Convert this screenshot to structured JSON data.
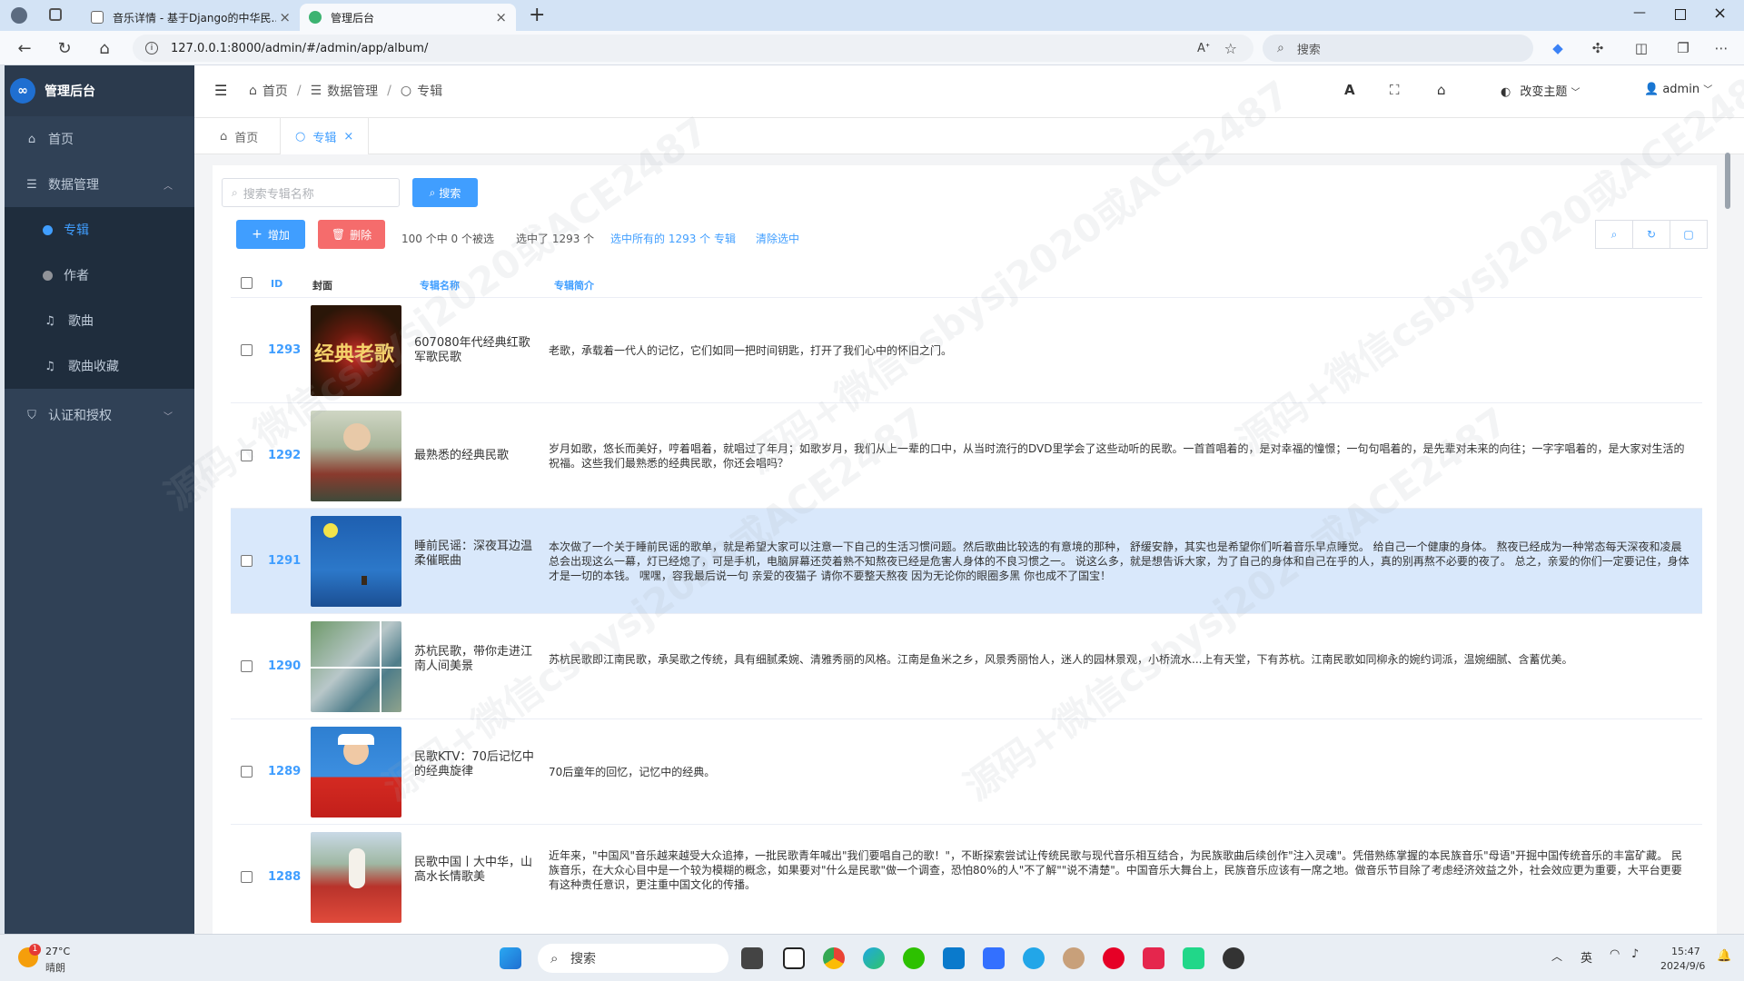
{
  "browser": {
    "tabs": [
      {
        "title": "音乐详情 - 基于Django的中华民..."
      },
      {
        "title": "管理后台"
      }
    ],
    "url": "127.0.0.1:8000/admin/#/admin/app/album/",
    "search_placeholder": "搜索"
  },
  "sidebar": {
    "brand": "管理后台",
    "home": "首页",
    "data_mgmt": "数据管理",
    "items": [
      {
        "label": "专辑"
      },
      {
        "label": "作者"
      },
      {
        "label": "歌曲"
      },
      {
        "label": "歌曲收藏"
      }
    ],
    "auth": "认证和授权"
  },
  "header": {
    "breadcrumb": [
      "首页",
      "数据管理",
      "专辑"
    ],
    "font_icon": "A",
    "theme": "改变主题",
    "user": "admin"
  },
  "page_tabs": [
    {
      "label": "首页"
    },
    {
      "label": "专辑"
    }
  ],
  "toolbar": {
    "search_placeholder": "搜索专辑名称",
    "search_btn": "搜索",
    "add_btn": "增加",
    "delete_btn": "删除",
    "selected_info": "100 个中 0 个被选",
    "selected_count": "选中了 1293 个",
    "select_all": "选中所有的 1293 个 专辑",
    "clear": "清除选中"
  },
  "table": {
    "columns": [
      "ID",
      "封面",
      "专辑名称",
      "专辑简介"
    ],
    "rows": [
      {
        "id": "1293",
        "name": "607080年代经典红歌军歌民歌",
        "desc": "老歌，承载着一代人的记忆，它们如同一把时间钥匙，打开了我们心中的怀旧之门。"
      },
      {
        "id": "1292",
        "name": "最熟悉的经典民歌",
        "desc": "岁月如歌，悠长而美好，哼着唱着，就唱过了年月；如歌岁月，我们从上一辈的口中，从当时流行的DVD里学会了这些动听的民歌。一首首唱着的，是对幸福的憧憬；一句句唱着的，是先辈对未来的向往；一字字唱着的，是大家对生活的祝福。这些我们最熟悉的经典民歌，你还会唱吗？"
      },
      {
        "id": "1291",
        "name": "睡前民谣：深夜耳边温柔催眠曲",
        "desc": "本次做了一个关于睡前民谣的歌单，就是希望大家可以注意一下自己的生活习惯问题。然后歌曲比较选的有意境的那种， 舒缓安静，其实也是希望你们听着音乐早点睡觉。 给自己一个健康的身体。 熬夜已经成为一种常态每天深夜和凌晨总会出现这么一幕，灯已经熄了，可是手机，电脑屏幕还荧着熟不知熬夜已经是危害人身体的不良习惯之一。 说这么多，就是想告诉大家，为了自己的身体和自己在乎的人，真的别再熬不必要的夜了。 总之，亲爱的你们一定要记住，身体才是一切的本钱。 嘿嘿，容我最后说一句 亲爱的夜猫子 请你不要整天熬夜 因为无论你的眼圈多黑          你也成不了国宝！"
      },
      {
        "id": "1290",
        "name": "苏杭民歌，带你走进江南人间美景",
        "desc": "苏杭民歌即江南民歌，承吴歌之传统，具有细腻柔婉、清雅秀丽的风格。江南是鱼米之乡，风景秀丽怡人，迷人的园林景观，小桥流水...上有天堂，下有苏杭。江南民歌如同柳永的婉约词派，温婉细腻、含蓄优美。"
      },
      {
        "id": "1289",
        "name": "民歌KTV：70后记忆中的经典旋律",
        "desc": "70后童年的回忆，记忆中的经典。"
      },
      {
        "id": "1288",
        "name": "民歌中国丨大中华，山高水长情歌美",
        "desc": "近年来，\"中国风\"音乐越来越受大众追捧，一批民歌青年喊出\"我们要唱自己的歌！\"，不断探索尝试让传统民歌与现代音乐相互结合，为民族歌曲后续创作\"注入灵魂\"。凭借熟练掌握的本民族音乐\"母语\"开掘中国传统音乐的丰富矿藏。 民族音乐，在大众心目中是一个较为模糊的概念，如果要对\"什么是民歌\"做一个调查，恐怕80%的人\"不了解\"\"说不清楚\"。中国音乐大舞台上，民族音乐应该有一席之地。做音乐节目除了考虑经济效益之外，社会效应更为重要，大平台更要有这种责任意识，更注重中国文化的传播。"
      }
    ]
  },
  "taskbar": {
    "temp": "27°C",
    "weather": "晴朗",
    "search": "搜索",
    "lang": "英",
    "time": "15:47",
    "date": "2024/9/6",
    "badge": "1"
  },
  "watermark": "源码+微信csbysj2020或ACE2487"
}
